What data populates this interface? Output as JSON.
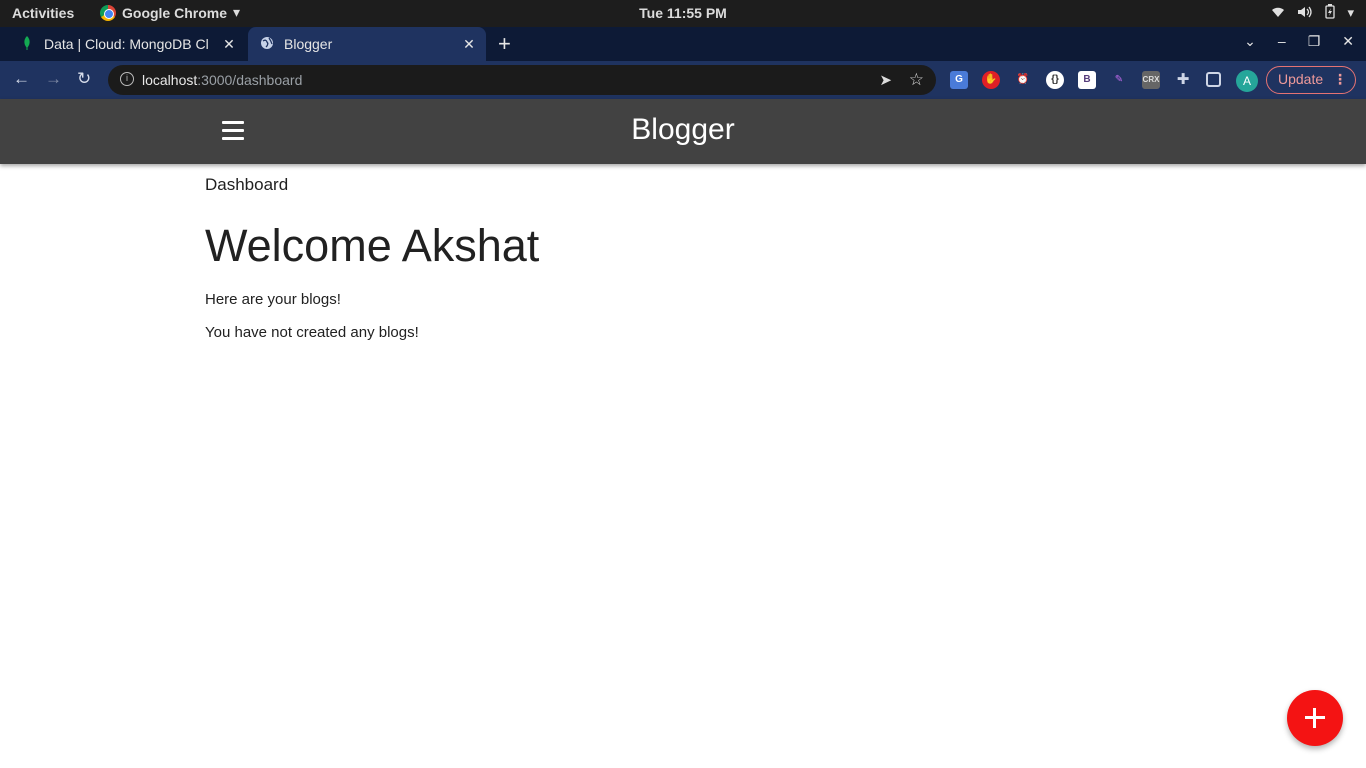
{
  "system_bar": {
    "activities": "Activities",
    "app_name": "Google Chrome",
    "clock": "Tue 11:55 PM"
  },
  "browser": {
    "tabs": [
      {
        "title": "Data | Cloud: MongoDB Cl",
        "icon": "mongodb-leaf-icon"
      },
      {
        "title": "Blogger",
        "icon": "globe-icon",
        "active": true
      }
    ],
    "url_host": "localhost",
    "url_path": ":3000/dashboard",
    "profile_initial": "A",
    "update_label": "Update",
    "extensions": [
      "google-translate",
      "adblock",
      "alarm",
      "json-viewer",
      "bootstrap",
      "feather",
      "crx",
      "puzzle"
    ]
  },
  "app": {
    "brand": "Blogger",
    "breadcrumb": "Dashboard",
    "welcome": "Welcome Akshat",
    "intro": "Here are your blogs!",
    "empty_message": "You have not created any blogs!"
  },
  "colors": {
    "header_bg": "#424242",
    "fab": "#f41313",
    "toolbar": "#1f3360",
    "tabstrip": "#0d1a36"
  }
}
